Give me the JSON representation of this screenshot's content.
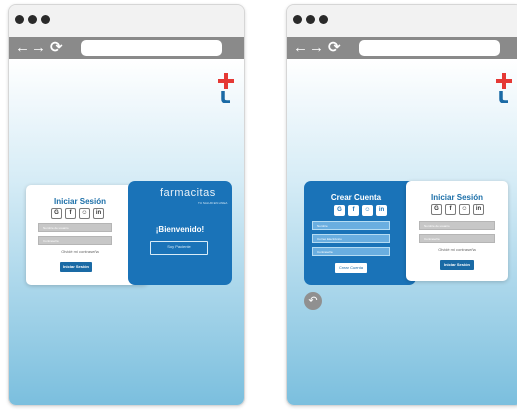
{
  "login_panel": {
    "title": "Iniciar Sesión",
    "social_icons": [
      "G",
      "f",
      "☺",
      "in"
    ],
    "user_placeholder": "Nombre de usuario",
    "password_placeholder": "Contraseña",
    "forgot_password": "Olvidé mi contraseña",
    "login_button": "Iniciar Sesión"
  },
  "welcome_panel": {
    "brand": "farmacitas",
    "brand_sub": "TU SALUD EN LINEA",
    "heading": "¡Bienvenido!",
    "button": "Soy Paciente"
  },
  "signup_panel": {
    "title": "Crear Cuenta",
    "social_icons": [
      "G",
      "f",
      "☺",
      "in"
    ],
    "name_placeholder": "Nombre",
    "email_placeholder": "Correo Electrónico",
    "password_placeholder": "Contraseña",
    "button": "Crear Cuenta"
  },
  "colors": {
    "brand_blue": "#1a73b8",
    "logo_red": "#e53935",
    "logo_blue": "#1a6aa5"
  },
  "icons": {
    "back": "←",
    "forward": "→",
    "reload": "⟳",
    "undo": "↶"
  }
}
